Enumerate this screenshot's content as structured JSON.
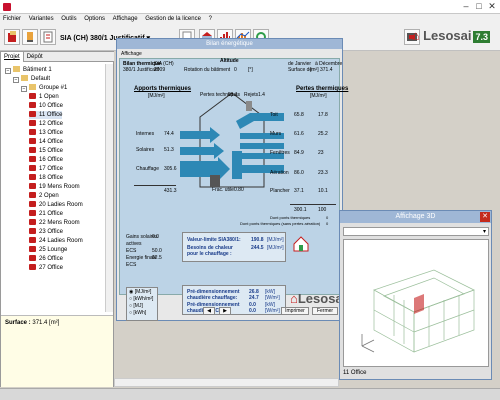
{
  "app": {
    "title": "",
    "window_controls": [
      "–",
      "□",
      "✕"
    ]
  },
  "menu": [
    "Fichier",
    "Variantes",
    "Outils",
    "Options",
    "Affichage",
    "Gestion de la licence",
    "?"
  ],
  "toolbar": {
    "norm_label": "SIA (CH) 380/1 Justificatif",
    "logo_text": "Lesosai",
    "logo_version": "7.3"
  },
  "left_tabs": [
    "Projet",
    "Dépôt"
  ],
  "tree": [
    {
      "label": "Bâtiment 1",
      "level": 0,
      "kind": "folder"
    },
    {
      "label": "Default",
      "level": 1,
      "kind": "folder"
    },
    {
      "label": "Groupe #1",
      "level": 2,
      "kind": "folder"
    },
    {
      "label": "1 Open",
      "level": 3,
      "kind": "room"
    },
    {
      "label": "10 Office",
      "level": 3,
      "kind": "room"
    },
    {
      "label": "11 Office",
      "level": 3,
      "kind": "room",
      "selected": true
    },
    {
      "label": "12 Office",
      "level": 3,
      "kind": "room"
    },
    {
      "label": "13 Office",
      "level": 3,
      "kind": "room"
    },
    {
      "label": "14 Office",
      "level": 3,
      "kind": "room"
    },
    {
      "label": "15 Office",
      "level": 3,
      "kind": "room"
    },
    {
      "label": "16 Office",
      "level": 3,
      "kind": "room"
    },
    {
      "label": "17 Office",
      "level": 3,
      "kind": "room"
    },
    {
      "label": "18 Office",
      "level": 3,
      "kind": "room"
    },
    {
      "label": "19 Mens Room",
      "level": 3,
      "kind": "room"
    },
    {
      "label": "2 Open",
      "level": 3,
      "kind": "room"
    },
    {
      "label": "20 Ladies Room",
      "level": 3,
      "kind": "room"
    },
    {
      "label": "21 Office",
      "level": 3,
      "kind": "room"
    },
    {
      "label": "22 Mens Room",
      "level": 3,
      "kind": "room"
    },
    {
      "label": "23 Office",
      "level": 3,
      "kind": "room"
    },
    {
      "label": "24 Ladies Room",
      "level": 3,
      "kind": "room"
    },
    {
      "label": "25 Lounge",
      "level": 3,
      "kind": "room"
    },
    {
      "label": "26 Office",
      "level": 3,
      "kind": "room"
    },
    {
      "label": "27 Office",
      "level": 3,
      "kind": "room"
    }
  ],
  "surface": {
    "label": "Surface :",
    "value": "371.4 [m²]"
  },
  "dialog": {
    "title": "Bilan énergétique",
    "subtitle": "Affichage",
    "header": {
      "bilan_label": "Bilan thermique",
      "bilan_val": "SIA (CH)",
      "norme_label": "380/1 Justificatif",
      "norme_val": "2009",
      "altitude_label": "Altitude",
      "rotation_label": "Rotation du bâtiment",
      "rotation_val": "0",
      "rotation_unit": "[°]",
      "period_from": "de Janvier",
      "period_to": "à Décembre",
      "surface_ref_label": "Surface de",
      "surface_ref_val": "[m²] 371.4"
    },
    "apports_title": "Apports thermiques",
    "apports_unit": "[MJ/m²]",
    "apports": [
      {
        "label": "Internes",
        "value": "74.4"
      },
      {
        "label": "Solaires",
        "value": "51.3"
      },
      {
        "label": "Chauffage",
        "value": "305.6"
      }
    ],
    "apports_total": "431.3",
    "pertes_title": "Pertes thermiques",
    "pertes_unit": "[MJ/m²]",
    "pertes_cols": [
      "Pertes techniques",
      "Rejets"
    ],
    "pertes_cols_vals": [
      "61.1",
      "1.4"
    ],
    "pertes": [
      {
        "label": "Toit",
        "v1": "65.8",
        "v2": "17.8"
      },
      {
        "label": "Murs",
        "v1": "61.6",
        "v2": "25.2"
      },
      {
        "label": "Fenêtres",
        "v1": "84.9",
        "v2": "23"
      },
      {
        "label": "Aération",
        "v1": "86.0",
        "v2": "23.3"
      },
      {
        "label": "Plancher",
        "v1": "37.1",
        "v2": "10.1"
      }
    ],
    "pertes_total_1": "300.1",
    "pertes_total_2": "100",
    "frac_utile_label": "Frac. utile",
    "frac_utile_val": "0.80",
    "ponts_label": "Dont ponts thermiques",
    "ponts_val": "0",
    "ponts_sans_label": "Dont ponts thermiques (sans pertes aération)",
    "ponts_sans_val": "0",
    "left_stats": [
      {
        "label": "Gains solaires",
        "value": "0.0"
      },
      {
        "label": "actives",
        "value": ""
      },
      {
        "label": "ECS",
        "value": "50.0"
      },
      {
        "label": "Energie finale",
        "value": "62.5"
      },
      {
        "label": "ECS",
        "value": ""
      }
    ],
    "valeur_limite_label": "Valeur-limite SIA380/1:",
    "valeur_limite_val": "190.8",
    "valeur_limite_unit": "[MJ/m²]",
    "besoins_label": "Besoins de chaleur pour le chauffage :",
    "besoins_val": "244.5",
    "besoins_unit": "[MJ/m²]",
    "unit_options": [
      "[MJ/m²]",
      "[kWh/m²]",
      "[MJ]",
      "[kWh]"
    ],
    "predim_chauffage_label": "Pré-dimensionnement chaudière chauffage:",
    "predim_chauffage_val": "26.8",
    "predim_chauffage_unit": "[kW]",
    "predim_chauffage_val2": "24.7",
    "predim_chauffage_unit2": "[W/m²]",
    "predim_ecs_label": "Pré-dimensionnement chaudière ECS:",
    "predim_ecs_val": "0.0",
    "predim_ecs_unit": "[kW]",
    "predim_ecs_val2": "0.0",
    "predim_ecs_unit2": "[W/m²]",
    "lesosai_text": "Lesosai",
    "btn_print": "Imprimer",
    "btn_close": "Fermer"
  },
  "view3d": {
    "title": "Affichage 3D",
    "footer": "11 Office"
  },
  "colors": {
    "accent": "#c41e1e",
    "dialog_bg": "#bcd3e6",
    "title_bar": "#9fb7d6",
    "duct": "#2d88b5"
  }
}
